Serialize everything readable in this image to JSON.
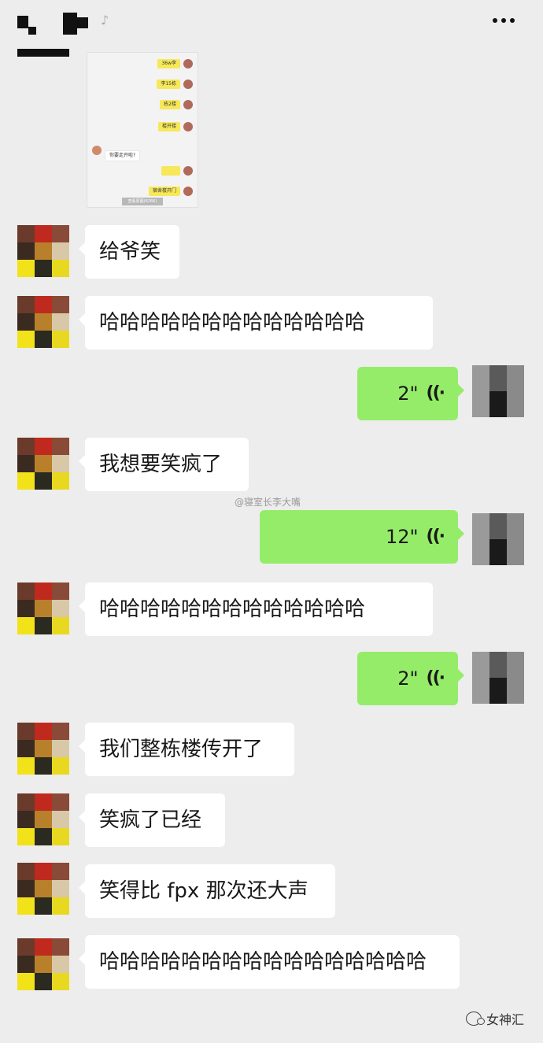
{
  "embedded_screenshot": {
    "sent_items": [
      "36w李",
      "李15栋",
      "栋2楼",
      "楼开楼",
      "",
      "宿舍楼开门"
    ],
    "received_text": "你要走开啦?",
    "bottom_bar": "查看原图(626K)"
  },
  "messages": [
    {
      "sender": "friend",
      "text": "给爷笑"
    },
    {
      "sender": "friend",
      "text": "哈哈哈哈哈哈哈哈哈哈哈哈哈"
    },
    {
      "sender": "me",
      "duration": "2\""
    },
    {
      "sender": "friend",
      "text": "我想要笑疯了"
    },
    {
      "sender": "me",
      "duration": "12\""
    },
    {
      "sender": "friend",
      "text": "哈哈哈哈哈哈哈哈哈哈哈哈哈"
    },
    {
      "sender": "me",
      "duration": "2\""
    },
    {
      "sender": "friend",
      "text": "我们整栋楼传开了"
    },
    {
      "sender": "friend",
      "text": "笑疯了已经"
    },
    {
      "sender": "friend",
      "text": "笑得比 fpx 那次还大声"
    },
    {
      "sender": "friend",
      "text": "哈哈哈哈哈哈哈哈哈哈哈哈哈哈哈哈"
    }
  ],
  "voice_icon": "voice-wave-icon",
  "watermark": "@寝室长李大嘴",
  "brand": {
    "name": "女神汇",
    "icon": "wechat-official-account-icon"
  },
  "colors": {
    "background": "#ededed",
    "sent_bubble": "#95ec69",
    "received_bubble": "#ffffff"
  }
}
